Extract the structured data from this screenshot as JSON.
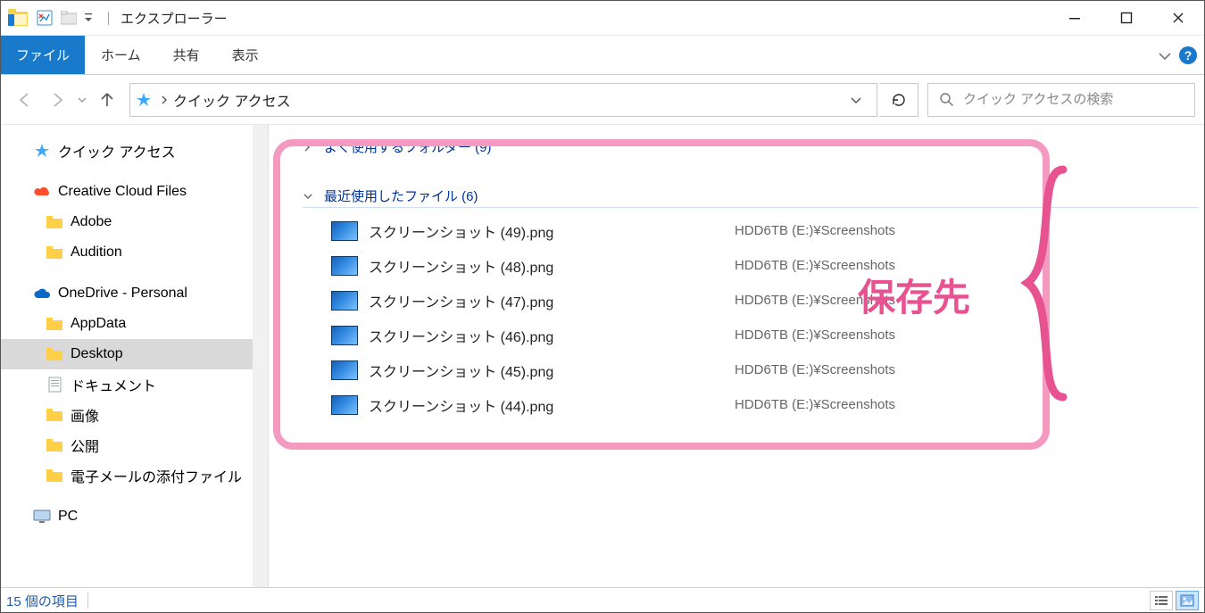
{
  "window": {
    "title": "エクスプローラー",
    "separator": "｜"
  },
  "ribbon": {
    "file": "ファイル",
    "home": "ホーム",
    "share": "共有",
    "view": "表示"
  },
  "address": {
    "location": "クイック アクセス"
  },
  "search": {
    "placeholder": "クイック アクセスの検索"
  },
  "tree": {
    "quick_access": "クイック アクセス",
    "creative_cloud": "Creative Cloud Files",
    "adobe": "Adobe",
    "audition": "Audition",
    "onedrive": "OneDrive - Personal",
    "appdata": "AppData",
    "desktop": "Desktop",
    "documents": "ドキュメント",
    "pictures": "画像",
    "public": "公開",
    "email_attach": "電子メールの添付ファイル",
    "pc": "PC"
  },
  "groups": {
    "frequent": "よく使用するフォルダー (9)",
    "recent": "最近使用したファイル (6)"
  },
  "files": [
    {
      "name": "スクリーンショット (49).png",
      "location": "HDD6TB (E:)¥Screenshots"
    },
    {
      "name": "スクリーンショット (48).png",
      "location": "HDD6TB (E:)¥Screenshots"
    },
    {
      "name": "スクリーンショット (47).png",
      "location": "HDD6TB (E:)¥Screenshots"
    },
    {
      "name": "スクリーンショット (46).png",
      "location": "HDD6TB (E:)¥Screenshots"
    },
    {
      "name": "スクリーンショット (45).png",
      "location": "HDD6TB (E:)¥Screenshots"
    },
    {
      "name": "スクリーンショット (44).png",
      "location": "HDD6TB (E:)¥Screenshots"
    }
  ],
  "status": {
    "text": "15 個の項目"
  },
  "annotation": {
    "label": "保存先"
  }
}
